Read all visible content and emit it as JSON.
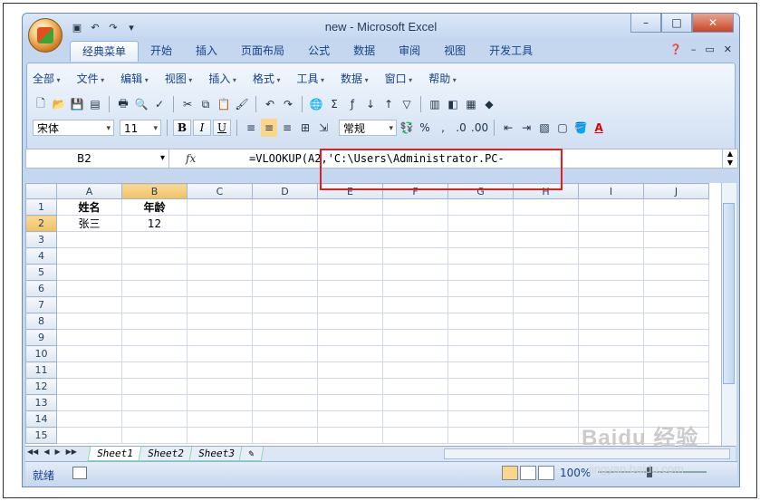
{
  "app": {
    "title": "new - Microsoft Excel"
  },
  "ribbon_tabs": [
    "经典菜单",
    "开始",
    "插入",
    "页面布局",
    "公式",
    "数据",
    "审阅",
    "视图",
    "开发工具"
  ],
  "menus": [
    "全部",
    "文件",
    "编辑",
    "视图",
    "插入",
    "格式",
    "工具",
    "数据",
    "窗口",
    "帮助"
  ],
  "font": {
    "name": "宋体",
    "size": "11"
  },
  "format_buttons": {
    "bold": "B",
    "italic": "I",
    "underline": "U"
  },
  "number_format": "常规",
  "formula_bar": {
    "cell_ref": "B2",
    "fx_label": "fx",
    "formula": "=VLOOKUP(A2,'C:\\Users\\Administrator.PC-"
  },
  "grid": {
    "columns": [
      "A",
      "B",
      "C",
      "D",
      "E",
      "F",
      "G",
      "H",
      "I",
      "J"
    ],
    "rows": [
      [
        "姓名",
        "年龄",
        "",
        "",
        "",
        "",
        "",
        "",
        "",
        ""
      ],
      [
        "张三",
        "12",
        "",
        "",
        "",
        "",
        "",
        "",
        "",
        ""
      ],
      [
        "",
        "",
        "",
        "",
        "",
        "",
        "",
        "",
        "",
        ""
      ],
      [
        "",
        "",
        "",
        "",
        "",
        "",
        "",
        "",
        "",
        ""
      ],
      [
        "",
        "",
        "",
        "",
        "",
        "",
        "",
        "",
        "",
        ""
      ],
      [
        "",
        "",
        "",
        "",
        "",
        "",
        "",
        "",
        "",
        ""
      ],
      [
        "",
        "",
        "",
        "",
        "",
        "",
        "",
        "",
        "",
        ""
      ],
      [
        "",
        "",
        "",
        "",
        "",
        "",
        "",
        "",
        "",
        ""
      ],
      [
        "",
        "",
        "",
        "",
        "",
        "",
        "",
        "",
        "",
        ""
      ],
      [
        "",
        "",
        "",
        "",
        "",
        "",
        "",
        "",
        "",
        ""
      ],
      [
        "",
        "",
        "",
        "",
        "",
        "",
        "",
        "",
        "",
        ""
      ],
      [
        "",
        "",
        "",
        "",
        "",
        "",
        "",
        "",
        "",
        ""
      ],
      [
        "",
        "",
        "",
        "",
        "",
        "",
        "",
        "",
        "",
        ""
      ],
      [
        "",
        "",
        "",
        "",
        "",
        "",
        "",
        "",
        "",
        ""
      ],
      [
        "",
        "",
        "",
        "",
        "",
        "",
        "",
        "",
        "",
        ""
      ]
    ]
  },
  "sheets": [
    "Sheet1",
    "Sheet2",
    "Sheet3"
  ],
  "status": {
    "ready": "就绪",
    "zoom": "100%"
  },
  "watermark": {
    "brand": "Baidu 经验",
    "url": "jingyan.baidu.com"
  }
}
